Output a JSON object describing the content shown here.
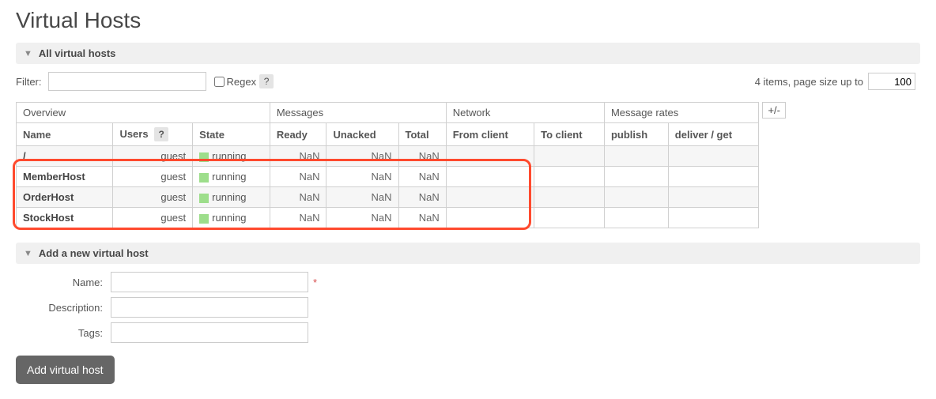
{
  "page_title": "Virtual Hosts",
  "sections": {
    "all_hosts": "All virtual hosts",
    "add_host": "Add a new virtual host"
  },
  "filter": {
    "label": "Filter:",
    "value": "",
    "regex_label": "Regex",
    "regex_checked": false,
    "help": "?"
  },
  "pagination": {
    "items_text": "4 items, page size up to",
    "page_size": "100"
  },
  "table": {
    "plusminus": "+/-",
    "group_headers": [
      "Overview",
      "Messages",
      "Network",
      "Message rates"
    ],
    "columns": [
      "Name",
      "Users",
      "State",
      "Ready",
      "Unacked",
      "Total",
      "From client",
      "To client",
      "publish",
      "deliver / get"
    ],
    "users_help": "?",
    "rows": [
      {
        "name": "/",
        "users": "guest",
        "state": "running",
        "ready": "NaN",
        "unacked": "NaN",
        "total": "NaN",
        "from_client": "",
        "to_client": "",
        "publish": "",
        "deliver": ""
      },
      {
        "name": "MemberHost",
        "users": "guest",
        "state": "running",
        "ready": "NaN",
        "unacked": "NaN",
        "total": "NaN",
        "from_client": "",
        "to_client": "",
        "publish": "",
        "deliver": ""
      },
      {
        "name": "OrderHost",
        "users": "guest",
        "state": "running",
        "ready": "NaN",
        "unacked": "NaN",
        "total": "NaN",
        "from_client": "",
        "to_client": "",
        "publish": "",
        "deliver": ""
      },
      {
        "name": "StockHost",
        "users": "guest",
        "state": "running",
        "ready": "NaN",
        "unacked": "NaN",
        "total": "NaN",
        "from_client": "",
        "to_client": "",
        "publish": "",
        "deliver": ""
      }
    ]
  },
  "form": {
    "name_label": "Name:",
    "name_value": "",
    "desc_label": "Description:",
    "desc_value": "",
    "tags_label": "Tags:",
    "tags_value": "",
    "mandatory": "*",
    "submit": "Add virtual host"
  }
}
